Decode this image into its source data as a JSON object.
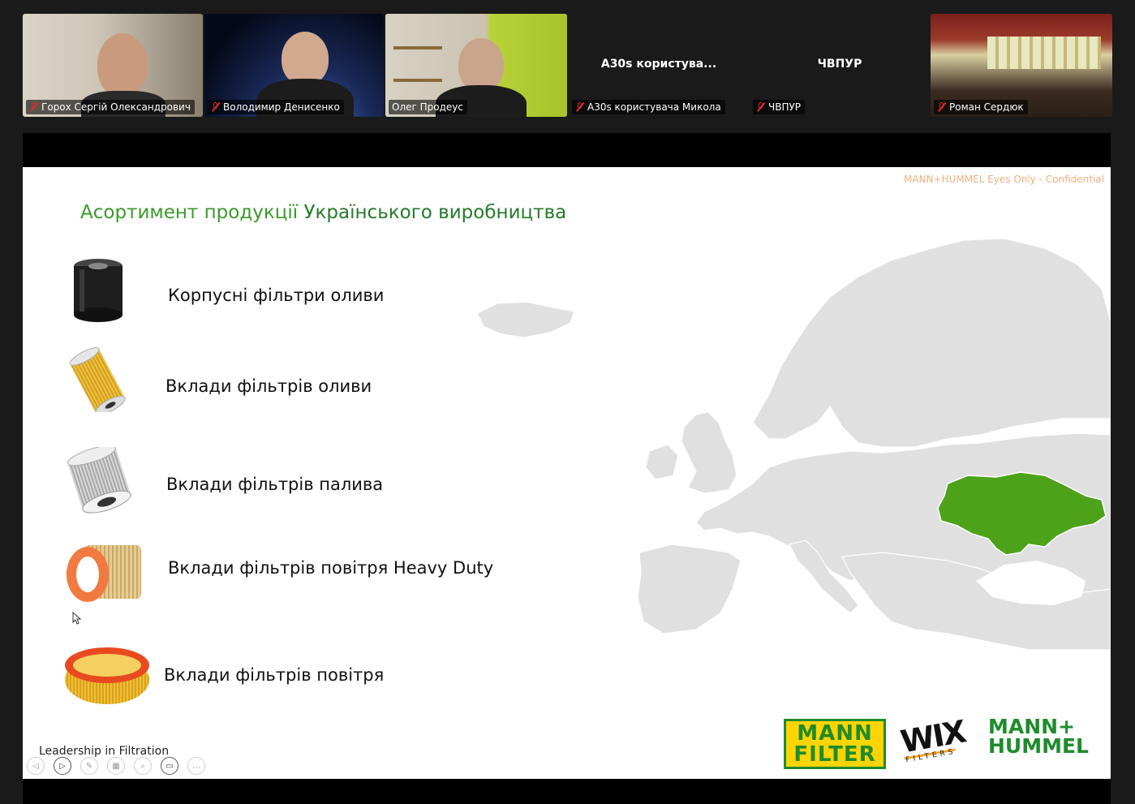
{
  "participants": [
    {
      "name": "Горох Сергій Олександрович",
      "muted": true,
      "video": true
    },
    {
      "name": "Володимир Денисенко",
      "muted": true,
      "video": true
    },
    {
      "name": "Олег Продеус",
      "muted": false,
      "video": true,
      "active": true
    },
    {
      "name": "A30s користувача Микола",
      "display_name": "A30s користува...",
      "muted": true,
      "video": false
    },
    {
      "name": "ЧВПУР",
      "display_name": "ЧВПУР",
      "muted": true,
      "video": false
    },
    {
      "name": "Роман Сердюк",
      "muted": true,
      "video": true
    }
  ],
  "slide": {
    "confidential": "MANN+HUMMEL Eyes Only - Confidential",
    "title_part1": "Асортимент продукції ",
    "title_part2": "Українського виробництва",
    "products": [
      {
        "label": "Корпусні фільтри оливи",
        "icon": "spin-on-oil-filter"
      },
      {
        "label": "Вклади фільтрів оливи",
        "icon": "oil-filter-element"
      },
      {
        "label": "Вклади фільтрів палива",
        "icon": "fuel-filter-element"
      },
      {
        "label": "Вклади фільтрів повітря Heavy Duty",
        "icon": "hd-air-filter"
      },
      {
        "label": "Вклади фільтрів повітря",
        "icon": "air-filter-element"
      }
    ],
    "footer": "Leadership in Filtration",
    "logos": {
      "mann_filter": [
        "MANN",
        "FILTER"
      ],
      "wix": {
        "word": "WIX",
        "sub": "FILTERS"
      },
      "mann_hummel": [
        "MANN+",
        "HUMMEL"
      ]
    },
    "map": {
      "highlight_country": "Ukraine",
      "highlight_color": "#4ca319",
      "base_color": "#e0e0e0"
    }
  },
  "colors": {
    "active_border": "#23d959",
    "muted_mic": "#e02828",
    "title_green": "#3a9a2a"
  }
}
